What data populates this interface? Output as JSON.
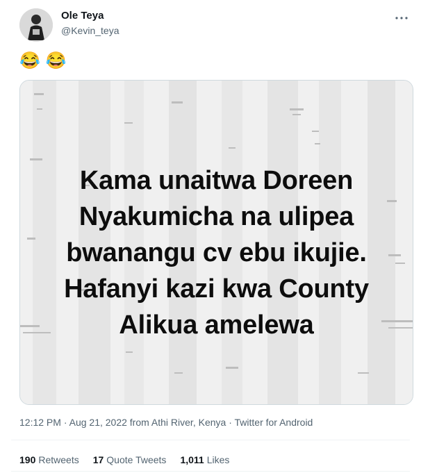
{
  "author": {
    "name": "Ole Teya",
    "handle": "@Kevin_teya"
  },
  "tweet": {
    "emojis": [
      "😂",
      "😂"
    ],
    "media_text_lines": [
      "Kama unaitwa Doreen",
      "Nyakumicha na ulipea",
      "bwanangu cv ebu ikujie.",
      "Hafanyi kazi kwa County",
      "Alikua amelewa"
    ]
  },
  "meta": {
    "time": "12:12 PM",
    "sep1": " · ",
    "date": "Aug 21, 2022 from Athi River, Kenya",
    "sep2": " · ",
    "source": "Twitter for Android"
  },
  "stats": {
    "retweets_count": "190",
    "retweets_label": "Retweets",
    "quotes_count": "17",
    "quotes_label": "Quote Tweets",
    "likes_count": "1,011",
    "likes_label": "Likes"
  },
  "icons": {
    "more": "more-dots-icon",
    "avatar": "user-avatar"
  }
}
